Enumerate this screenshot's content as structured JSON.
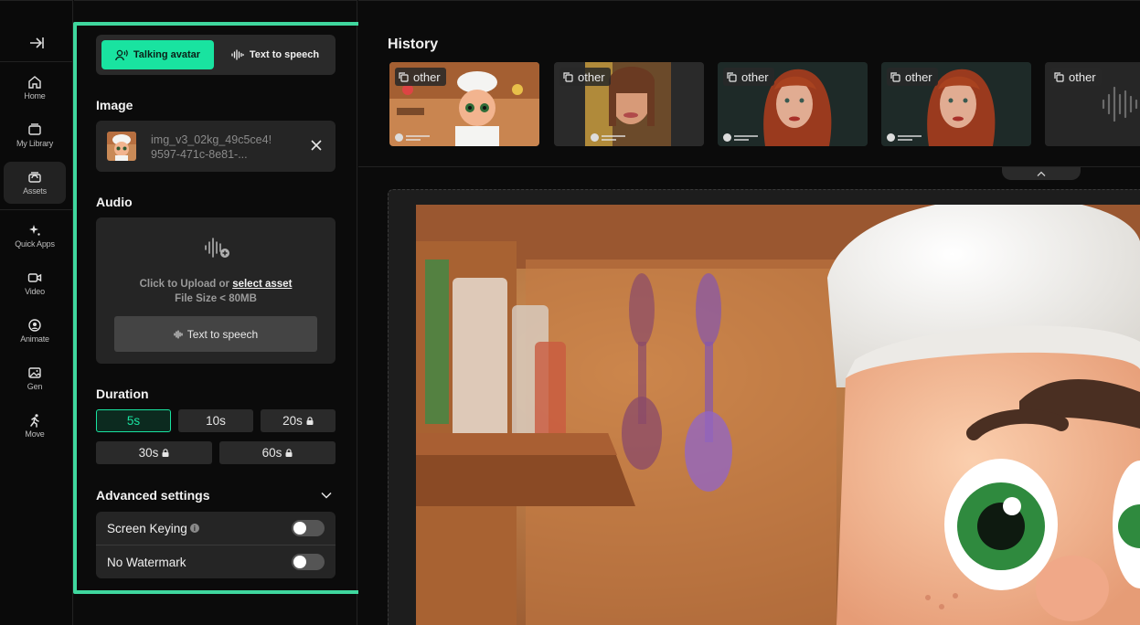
{
  "nav": {
    "items": [
      {
        "label": "Home",
        "icon": "home-icon"
      },
      {
        "label": "My Library",
        "icon": "library-icon"
      },
      {
        "label": "Assets",
        "icon": "assets-icon",
        "active": true
      },
      {
        "label": "Quick Apps",
        "icon": "sparkle-icon"
      },
      {
        "label": "Video",
        "icon": "video-icon"
      },
      {
        "label": "Animate",
        "icon": "animate-icon"
      },
      {
        "label": "Gen",
        "icon": "image-icon"
      },
      {
        "label": "Move",
        "icon": "run-icon"
      }
    ]
  },
  "panel": {
    "mode": {
      "active_label": "Talking avatar",
      "inactive_label": "Text to speech"
    },
    "image": {
      "title": "Image",
      "file_line1": "img_v3_02kg_49c5ce4!",
      "file_line2": "9597-471c-8e81-..."
    },
    "audio": {
      "title": "Audio",
      "upload_prefix": "Click to Upload or ",
      "upload_link": "select asset",
      "size_hint": "File Size < 80MB",
      "tts_button": "Text to speech"
    },
    "duration": {
      "title": "Duration",
      "options": [
        {
          "label": "5s",
          "selected": true,
          "locked": false
        },
        {
          "label": "10s",
          "selected": false,
          "locked": false
        },
        {
          "label": "20s",
          "selected": false,
          "locked": true
        },
        {
          "label": "30s",
          "selected": false,
          "locked": true
        },
        {
          "label": "60s",
          "selected": false,
          "locked": true
        }
      ]
    },
    "advanced": {
      "title": "Advanced settings",
      "toggles": [
        {
          "label": "Screen Keying",
          "info": "i",
          "on": false
        },
        {
          "label": "No Watermark",
          "on": false
        }
      ]
    }
  },
  "history": {
    "title": "History",
    "items": [
      {
        "badge": "other"
      },
      {
        "badge": "other"
      },
      {
        "badge": "other"
      },
      {
        "badge": "other"
      },
      {
        "badge": "other"
      }
    ]
  },
  "colors": {
    "accent": "#19e3a0",
    "highlight": "#3fd79e",
    "background": "#0b0b0b",
    "card": "#252525"
  }
}
